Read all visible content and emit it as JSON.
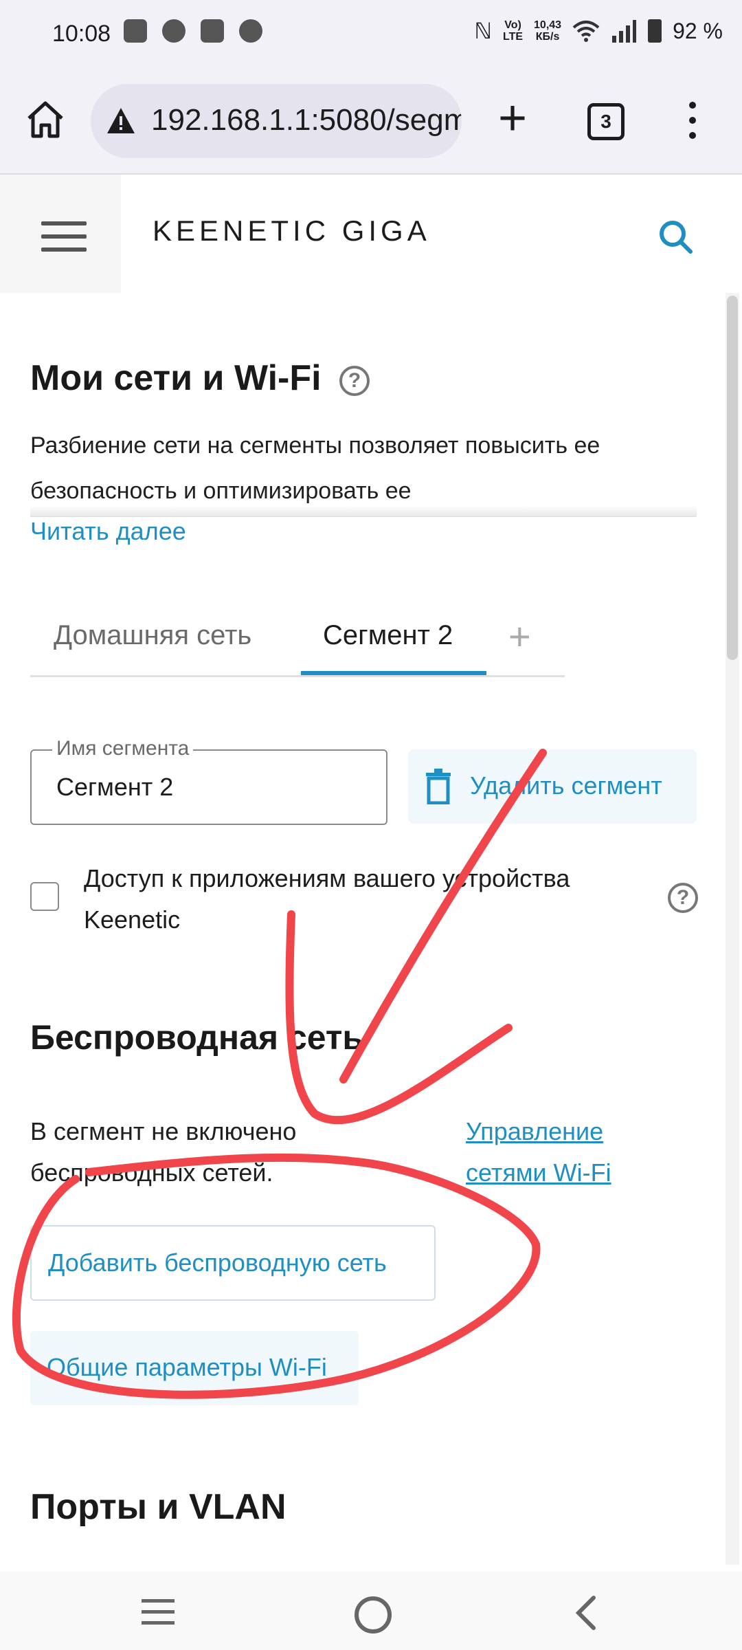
{
  "status_bar": {
    "time": "10:08",
    "net_speed_top": "10,43",
    "net_speed_bottom": "КБ/s",
    "volte_top": "Vo)",
    "volte_bottom": "LTE",
    "battery": "92 %"
  },
  "browser": {
    "url": "192.168.1.1:5080/segm",
    "tab_count": "3"
  },
  "header": {
    "brand": "KEENETIC GIGA"
  },
  "page": {
    "title": "Мои сети и Wi-Fi",
    "description": "Разбиение сети на сегменты позволяет повысить ее безопасность и оптимизировать ее",
    "read_more": "Читать далее",
    "tabs": [
      {
        "label": "Домашняя сеть"
      },
      {
        "label": "Сегмент 2"
      }
    ],
    "add_tab": "+",
    "segment_name_legend": "Имя сегмента",
    "segment_name_value": "Сегмент 2",
    "delete_segment": "Удалить сегмент",
    "app_access_label": "Доступ к приложениям вашего устройства Keenetic",
    "wireless_title": "Беспроводная сеть",
    "wireless_note": "В сегмент не включено беспроводных сетей.",
    "manage_wifi_link": "Управление сетями Wi-Fi",
    "add_wireless_button": "Добавить беспроводную сеть",
    "common_wifi_button": "Общие параметры Wi-Fi",
    "ports_title": "Порты и VLAN"
  },
  "colors": {
    "accent": "#1f8ec2",
    "annotation": "#f0454b"
  }
}
